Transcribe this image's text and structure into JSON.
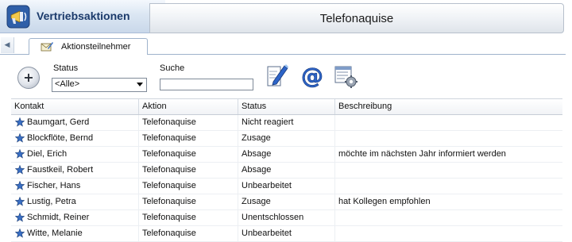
{
  "app": {
    "title": "Vertriebsaktionen",
    "icon": "megaphone-icon"
  },
  "header": {
    "title": "Telefonaquise"
  },
  "tabs": [
    {
      "label": "Aktionsteilnehmer",
      "icon": "envelope-edit-icon",
      "active": true
    }
  ],
  "toolbar": {
    "add_icon": "plus-circle-icon",
    "status_label": "Status",
    "status_value": "<Alle>",
    "search_label": "Suche",
    "search_value": "",
    "tools": [
      "edit-pen-icon",
      "email-at-icon",
      "list-settings-icon"
    ]
  },
  "table": {
    "columns": [
      "Kontakt",
      "Aktion",
      "Status",
      "Beschreibung"
    ],
    "rows": [
      {
        "kontakt": "Baumgart, Gerd",
        "aktion": "Telefonaquise",
        "status": "Nicht reagiert",
        "beschreibung": ""
      },
      {
        "kontakt": "Blockflöte, Bernd",
        "aktion": "Telefonaquise",
        "status": "Zusage",
        "beschreibung": ""
      },
      {
        "kontakt": "Diel, Erich",
        "aktion": "Telefonaquise",
        "status": "Absage",
        "beschreibung": "möchte im nächsten Jahr informiert werden"
      },
      {
        "kontakt": "Faustkeil, Robert",
        "aktion": "Telefonaquise",
        "status": "Absage",
        "beschreibung": ""
      },
      {
        "kontakt": "Fischer, Hans",
        "aktion": "Telefonaquise",
        "status": "Unbearbeitet",
        "beschreibung": ""
      },
      {
        "kontakt": "Lustig, Petra",
        "aktion": "Telefonaquise",
        "status": "Zusage",
        "beschreibung": "hat Kollegen empfohlen"
      },
      {
        "kontakt": "Schmidt, Reiner",
        "aktion": "Telefonaquise",
        "status": "Unentschlossen",
        "beschreibung": ""
      },
      {
        "kontakt": "Witte, Melanie",
        "aktion": "Telefonaquise",
        "status": "Unbearbeitet",
        "beschreibung": ""
      }
    ]
  },
  "colors": {
    "accent": "#1b3a6b",
    "star": "#3a6fc4",
    "header_gradient_end": "#c9d8ea"
  }
}
